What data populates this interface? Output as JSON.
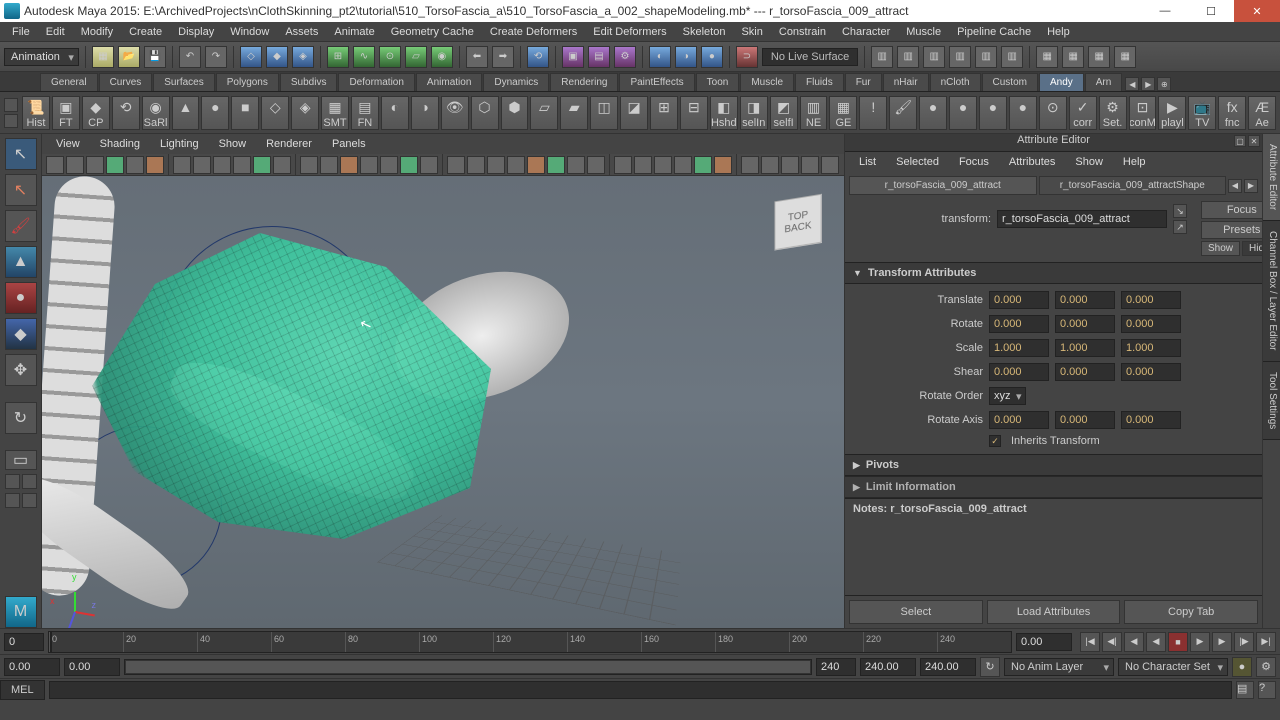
{
  "titlebar": {
    "title": "Autodesk Maya 2015: E:\\ArchivedProjects\\nClothSkinning_pt2\\tutorial\\510_TorsoFascia_a\\510_TorsoFascia_a_002_shapeModeling.mb*  ---  r_torsoFascia_009_attract"
  },
  "menubar": [
    "File",
    "Edit",
    "Modify",
    "Create",
    "Display",
    "Window",
    "Assets",
    "Animate",
    "Geometry Cache",
    "Create Deformers",
    "Edit Deformers",
    "Skeleton",
    "Skin",
    "Constrain",
    "Character",
    "Muscle",
    "Pipeline Cache",
    "Help"
  ],
  "statusline": {
    "mode": "Animation",
    "nolive": "No Live Surface"
  },
  "shelf_tabs": [
    "General",
    "Curves",
    "Surfaces",
    "Polygons",
    "Subdivs",
    "Deformation",
    "Animation",
    "Dynamics",
    "Rendering",
    "PaintEffects",
    "Toon",
    "Muscle",
    "Fluids",
    "Fur",
    "nHair",
    "nCloth",
    "Custom",
    "Andy",
    "Arn"
  ],
  "shelf_active": "Andy",
  "shelf_icons": [
    "Hist",
    "FT",
    "CP",
    "",
    "SaRl",
    "",
    "",
    "",
    "",
    "",
    "SMT",
    "FN",
    "",
    "",
    "",
    "",
    "",
    "",
    "",
    "",
    "",
    "",
    "",
    "Hshd",
    "selIn",
    "selfI",
    "NE",
    "GE",
    "",
    "",
    "",
    "",
    "",
    "",
    "",
    "corr",
    "Set.",
    "conM",
    "playl",
    "TV",
    "fnc",
    "Ae"
  ],
  "viewport_menu": [
    "View",
    "Shading",
    "Lighting",
    "Show",
    "Renderer",
    "Panels"
  ],
  "viewcube": {
    "top": "TOP",
    "face": "BACK"
  },
  "attr_editor": {
    "title": "Attribute Editor",
    "menu": [
      "List",
      "Selected",
      "Focus",
      "Attributes",
      "Show",
      "Help"
    ],
    "tabs": [
      "r_torsoFascia_009_attract",
      "r_torsoFascia_009_attractShape"
    ],
    "active_tab": 0,
    "transform_label": "transform:",
    "transform_name": "r_torsoFascia_009_attract",
    "btns": {
      "focus": "Focus",
      "presets": "Presets",
      "show": "Show",
      "hide": "Hide"
    },
    "section_transform": "Transform Attributes",
    "rows": {
      "translate": {
        "label": "Translate",
        "v": [
          "0.000",
          "0.000",
          "0.000"
        ]
      },
      "rotate": {
        "label": "Rotate",
        "v": [
          "0.000",
          "0.000",
          "0.000"
        ]
      },
      "scale": {
        "label": "Scale",
        "v": [
          "1.000",
          "1.000",
          "1.000"
        ]
      },
      "shear": {
        "label": "Shear",
        "v": [
          "0.000",
          "0.000",
          "0.000"
        ]
      },
      "rotorder": {
        "label": "Rotate Order",
        "sel": "xyz"
      },
      "rotaxis": {
        "label": "Rotate Axis",
        "v": [
          "0.000",
          "0.000",
          "0.000"
        ]
      },
      "inherits": {
        "label": "Inherits Transform",
        "checked": true
      }
    },
    "section_pivots": "Pivots",
    "section_limit": "Limit Information",
    "notes_label": "Notes: r_torsoFascia_009_attract",
    "bottom_btns": [
      "Select",
      "Load Attributes",
      "Copy Tab"
    ]
  },
  "sidetabs": [
    "Attribute Editor",
    "Channel Box / Layer Editor",
    "Tool Settings"
  ],
  "timeline": {
    "start_field": "0",
    "ticks": [
      "0",
      "20",
      "40",
      "60",
      "80",
      "100",
      "120",
      "140",
      "160",
      "180",
      "200",
      "220",
      "240"
    ],
    "end_field": "0.00"
  },
  "range": {
    "start": "0.00",
    "inner_start": "0.00",
    "inner_end": "240",
    "end_a": "240.00",
    "end_b": "240.00",
    "animlayer": "No Anim Layer",
    "charset": "No Character Set"
  },
  "cmd": {
    "lang": "MEL"
  }
}
